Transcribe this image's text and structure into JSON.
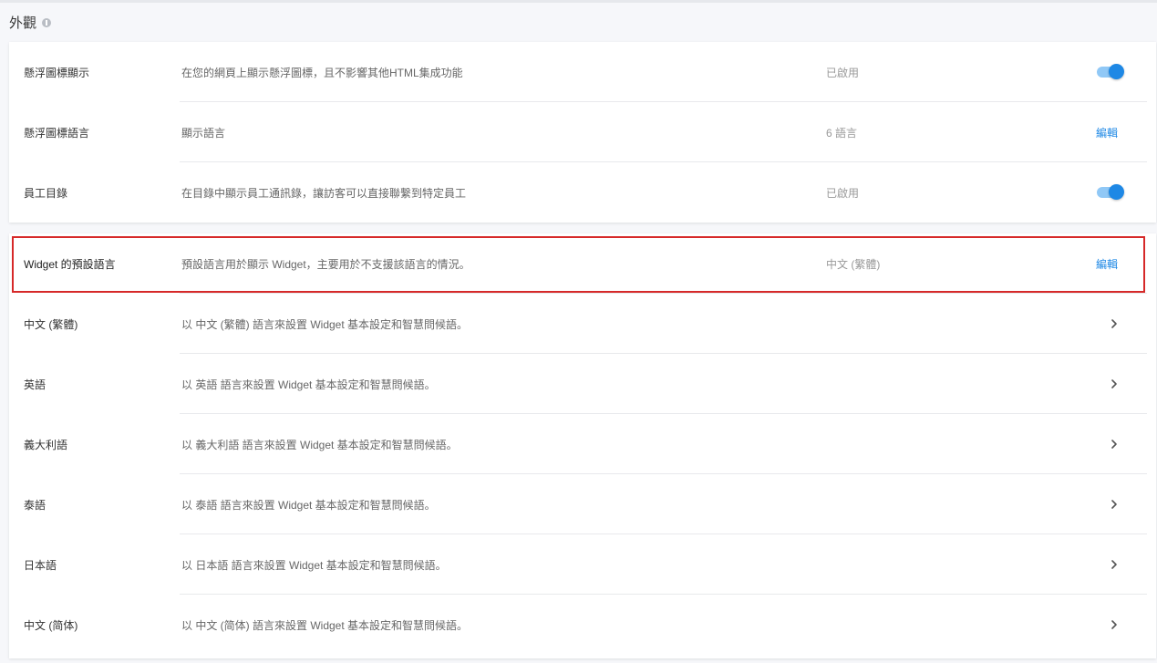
{
  "section": {
    "title": "外觀"
  },
  "settings": [
    {
      "name": "懸浮圖標顯示",
      "desc": "在您的網頁上顯示懸浮圖標，且不影響其他HTML集成功能",
      "status": "已啟用",
      "control": "toggle",
      "enabled": true
    },
    {
      "name": "懸浮圖標語言",
      "desc": "顯示語言",
      "status": "6 語言",
      "control": "edit",
      "edit_label": "編輯"
    },
    {
      "name": "員工目錄",
      "desc": "在目錄中顯示員工通訊錄，讓訪客可以直接聯繫到特定員工",
      "status": "已啟用",
      "control": "toggle",
      "enabled": true
    }
  ],
  "widget_default": {
    "name": "Widget 的預設語言",
    "desc": "預設語言用於顯示 Widget，主要用於不支援該語言的情況。",
    "status": "中文 (繁體)",
    "edit_label": "編輯"
  },
  "languages": [
    {
      "name": "中文 (繁體)",
      "desc": "以 中文 (繁體) 語言來設置 Widget 基本設定和智慧問候語。"
    },
    {
      "name": "英語",
      "desc": "以 英語 語言來設置 Widget 基本設定和智慧問候語。"
    },
    {
      "name": "義大利語",
      "desc": "以 義大利語 語言來設置 Widget 基本設定和智慧問候語。"
    },
    {
      "name": "泰語",
      "desc": "以 泰語 語言來設置 Widget 基本設定和智慧問候語。"
    },
    {
      "name": "日本語",
      "desc": "以 日本語 語言來設置 Widget 基本設定和智慧問候語。"
    },
    {
      "name": "中文 (简体)",
      "desc": "以 中文 (简体) 語言來設置 Widget 基本設定和智慧問候語。"
    }
  ],
  "icons": {
    "info": "info-icon",
    "chevron": "chevron-right-icon"
  },
  "colors": {
    "accent": "#1e88e5",
    "highlight_border": "#d62929"
  }
}
